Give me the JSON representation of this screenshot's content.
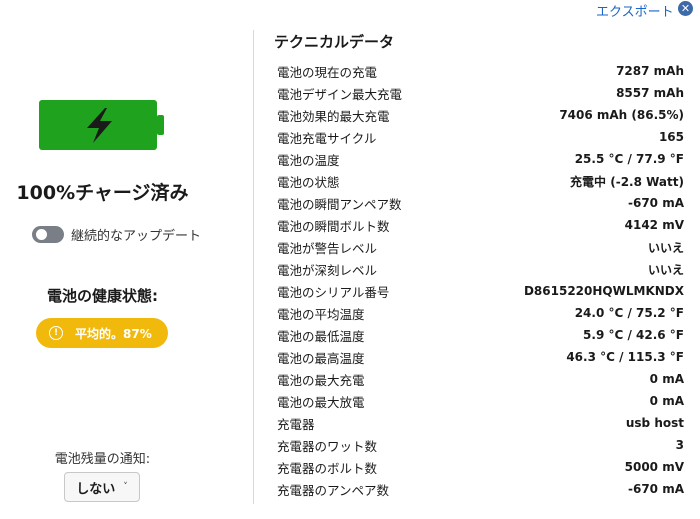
{
  "header": {
    "export_label": "エクスポート",
    "close_glyph": "✕"
  },
  "status": {
    "charge_title": "100%チャージ済み",
    "battery_color": "#1fa31f",
    "continuous_update_label": "継続的なアップデート",
    "continuous_update_on": false
  },
  "health": {
    "label": "電池の健康状態:",
    "badge_text": "平均的。87%",
    "badge_color": "#f2b90d",
    "icon_glyph": "!"
  },
  "notify": {
    "label": "電池残量の通知:",
    "selected": "しない",
    "chevron": "˅"
  },
  "tech": {
    "title": "テクニカルデータ",
    "rows": [
      {
        "label": "電池の現在の充電",
        "value": "7287 mAh"
      },
      {
        "label": "電池デザイン最大充電",
        "value": "8557 mAh"
      },
      {
        "label": "電池効果的最大充電",
        "value": "7406 mAh (86.5%)"
      },
      {
        "label": "電池充電サイクル",
        "value": "165"
      },
      {
        "label": "電池の温度",
        "value": "25.5 °C / 77.9 °F"
      },
      {
        "label": "電池の状態",
        "value": "充電中 (-2.8 Watt)"
      },
      {
        "label": "電池の瞬間アンペア数",
        "value": "-670 mA"
      },
      {
        "label": "電池の瞬間ボルト数",
        "value": "4142 mV"
      },
      {
        "label": "電池が警告レベル",
        "value": "いいえ"
      },
      {
        "label": "電池が深刻レベル",
        "value": "いいえ"
      },
      {
        "label": "電池のシリアル番号",
        "value": "D8615220HQWLMKNDX"
      },
      {
        "label": "電池の平均温度",
        "value": "24.0 °C / 75.2 °F"
      },
      {
        "label": "電池の最低温度",
        "value": "5.9 °C / 42.6 °F"
      },
      {
        "label": "電池の最高温度",
        "value": "46.3 °C / 115.3 °F"
      },
      {
        "label": "電池の最大充電",
        "value": "0 mA"
      },
      {
        "label": "電池の最大放電",
        "value": "0 mA"
      },
      {
        "label": "充電器",
        "value": "usb host"
      },
      {
        "label": "充電器のワット数",
        "value": "3"
      },
      {
        "label": "充電器のボルト数",
        "value": "5000 mV"
      },
      {
        "label": "充電器のアンペア数",
        "value": "-670 mA"
      }
    ]
  }
}
